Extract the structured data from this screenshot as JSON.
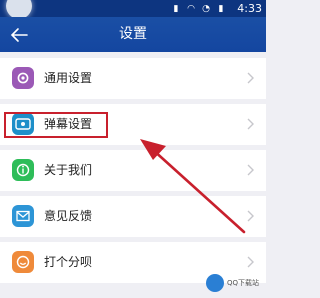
{
  "status_bar": {
    "time": "4:33",
    "icons": [
      "signal-icon",
      "wifi-icon",
      "alarm-icon",
      "battery-icon"
    ]
  },
  "header": {
    "title": "设置",
    "back_icon": "back-arrow-icon"
  },
  "settings": [
    {
      "label": "通用设置",
      "icon": "gear-icon",
      "color": "#9b59b6"
    },
    {
      "label": "弹幕设置",
      "icon": "danmaku-icon",
      "color": "#1e8fc9"
    },
    {
      "label": "关于我们",
      "icon": "info-icon",
      "color": "#2ebd59"
    },
    {
      "label": "意见反馈",
      "icon": "mail-icon",
      "color": "#2d95d6"
    },
    {
      "label": "打个分呗",
      "icon": "smile-icon",
      "color": "#ef8a3a"
    }
  ],
  "annotation": {
    "highlight_color": "#c8202d"
  },
  "watermark": {
    "text": "QQ下载站"
  }
}
